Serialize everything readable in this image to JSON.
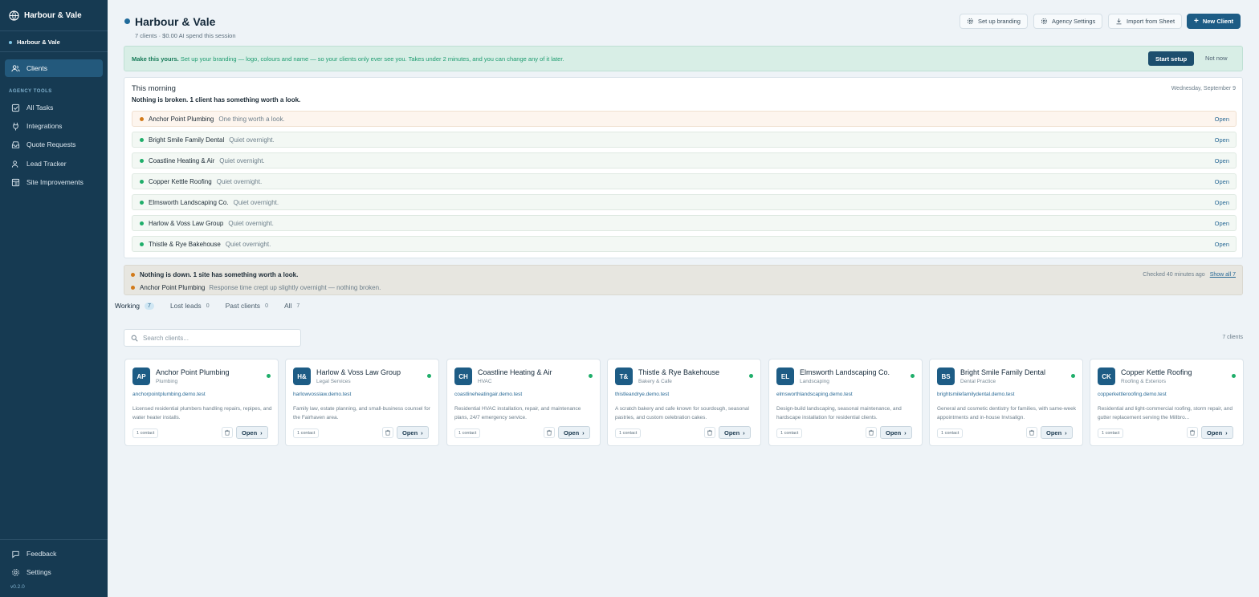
{
  "sidebar": {
    "brand": "Harbour & Vale",
    "workspace": "Harbour & Vale",
    "clients_label": "Clients",
    "section_label": "AGENCY TOOLS",
    "items": [
      {
        "label": "All Tasks"
      },
      {
        "label": "Integrations"
      },
      {
        "label": "Quote Requests"
      },
      {
        "label": "Lead Tracker"
      },
      {
        "label": "Site Improvements"
      }
    ],
    "feedback_label": "Feedback",
    "settings_label": "Settings",
    "version": "v0.2.0"
  },
  "header": {
    "title": "Harbour & Vale",
    "subtitle": "7 clients · $0.00 AI spend this session",
    "setup_branding": "Set up branding",
    "agency_settings": "Agency Settings",
    "import_sheet": "Import from Sheet",
    "new_client": "New Client"
  },
  "banner": {
    "bold": "Make this yours.",
    "text": " Set up your branding — logo, colours and name — so your clients only ever see you. Takes under 2 minutes, and you can change any of it later.",
    "start": "Start setup",
    "dismiss": "Not now"
  },
  "morning": {
    "title": "This morning",
    "summary": "Nothing is broken. 1 client has something worth a look.",
    "date": "Wednesday, September 9",
    "open_label": "Open",
    "rows": [
      {
        "name": "Anchor Point Plumbing",
        "note": "One thing worth a look.",
        "status": "warn"
      },
      {
        "name": "Bright Smile Family Dental",
        "note": "Quiet overnight.",
        "status": "ok"
      },
      {
        "name": "Coastline Heating & Air",
        "note": "Quiet overnight.",
        "status": "ok"
      },
      {
        "name": "Copper Kettle Roofing",
        "note": "Quiet overnight.",
        "status": "ok"
      },
      {
        "name": "Elmsworth Landscaping Co.",
        "note": "Quiet overnight.",
        "status": "ok"
      },
      {
        "name": "Harlow & Voss Law Group",
        "note": "Quiet overnight.",
        "status": "ok"
      },
      {
        "name": "Thistle & Rye Bakehouse",
        "note": "Quiet overnight.",
        "status": "ok"
      }
    ]
  },
  "uptime": {
    "summary": "Nothing is down. 1 site has something worth a look.",
    "site": "Anchor Point Plumbing",
    "note": "Response time crept up slightly overnight — nothing broken.",
    "checked": "Checked 40 minutes ago",
    "show_all": "Show all 7"
  },
  "tabs": [
    {
      "label": "Working",
      "count": "7"
    },
    {
      "label": "Lost leads",
      "count": "0"
    },
    {
      "label": "Past clients",
      "count": "0"
    },
    {
      "label": "All",
      "count": "7"
    }
  ],
  "search": {
    "placeholder": "Search clients..."
  },
  "client_count": "7 clients",
  "card_labels": {
    "contact": "1 contact",
    "open": "Open"
  },
  "clients": [
    {
      "initials": "AP",
      "name": "Anchor Point Plumbing",
      "industry": "Plumbing",
      "domain": "anchorpointplumbing.demo.test",
      "desc": "Licensed residential plumbers handling repairs, repipes, and water heater installs."
    },
    {
      "initials": "H&",
      "name": "Harlow & Voss Law Group",
      "industry": "Legal Services",
      "domain": "harlowvosslaw.demo.test",
      "desc": "Family law, estate planning, and small-business counsel for the Fairhaven area."
    },
    {
      "initials": "CH",
      "name": "Coastline Heating & Air",
      "industry": "HVAC",
      "domain": "coastlineheatingair.demo.test",
      "desc": "Residential HVAC installation, repair, and maintenance plans, 24/7 emergency service."
    },
    {
      "initials": "T&",
      "name": "Thistle & Rye Bakehouse",
      "industry": "Bakery & Cafe",
      "domain": "thistleandrye.demo.test",
      "desc": "A scratch bakery and cafe known for sourdough, seasonal pastries, and custom celebration cakes."
    },
    {
      "initials": "EL",
      "name": "Elmsworth Landscaping Co.",
      "industry": "Landscaping",
      "domain": "elmsworthlandscaping.demo.test",
      "desc": "Design-build landscaping, seasonal maintenance, and hardscape installation for residential clients."
    },
    {
      "initials": "BS",
      "name": "Bright Smile Family Dental",
      "industry": "Dental Practice",
      "domain": "brightsmilefamilydental.demo.test",
      "desc": "General and cosmetic dentistry for families, with same-week appointments and in-house Invisalign."
    },
    {
      "initials": "CK",
      "name": "Copper Kettle Roofing",
      "industry": "Roofing & Exteriors",
      "domain": "copperkettleroofing.demo.test",
      "desc": "Residential and light-commercial roofing, storm repair, and gutter replacement serving the Millbro..."
    }
  ]
}
